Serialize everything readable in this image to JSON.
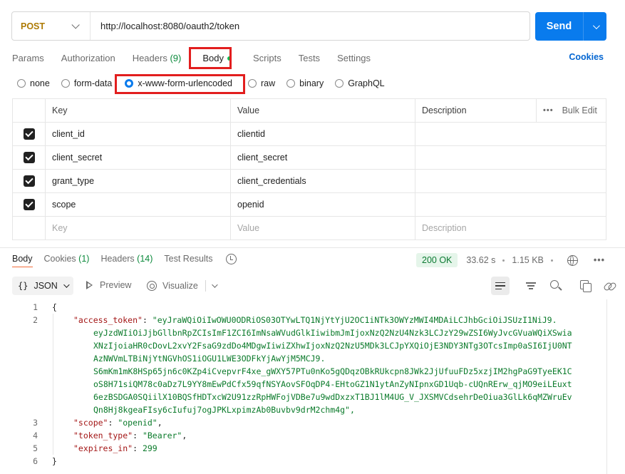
{
  "request": {
    "method": "POST",
    "url": "http://localhost:8080/oauth2/token",
    "send_label": "Send"
  },
  "request_tabs": {
    "params": "Params",
    "authorization": "Authorization",
    "headers": "Headers",
    "headers_count": "(9)",
    "body": "Body",
    "scripts": "Scripts",
    "tests": "Tests",
    "settings": "Settings",
    "cookies": "Cookies"
  },
  "body_types": {
    "none": "none",
    "form_data": "form-data",
    "urlencoded": "x-www-form-urlencoded",
    "raw": "raw",
    "binary": "binary",
    "graphql": "GraphQL",
    "selected": "x-www-form-urlencoded"
  },
  "params_table": {
    "headers": [
      "Key",
      "Value",
      "Description"
    ],
    "bulk_edit": "Bulk Edit",
    "rows": [
      {
        "key": "client_id",
        "value": "clientid",
        "checked": true
      },
      {
        "key": "client_secret",
        "value": "client_secret",
        "checked": true
      },
      {
        "key": "grant_type",
        "value": "client_credentials",
        "checked": true
      },
      {
        "key": "scope",
        "value": "openid",
        "checked": true
      }
    ],
    "placeholder": {
      "key": "Key",
      "value": "Value",
      "description": "Description"
    }
  },
  "response_tabs": {
    "body": "Body",
    "cookies": "Cookies",
    "cookies_count": "(1)",
    "headers": "Headers",
    "headers_count": "(14)",
    "test_results": "Test Results"
  },
  "response_status": {
    "code": "200 OK",
    "time": "33.62 s",
    "size": "1.15 KB"
  },
  "response_toolbar": {
    "format": "JSON",
    "preview": "Preview",
    "visualize": "Visualize"
  },
  "response_body": {
    "line_numbers": [
      "1",
      "2",
      "3",
      "4",
      "5",
      "6"
    ],
    "open_brace": "{",
    "close_brace": "}",
    "access_token_key": "\"access_token\"",
    "access_token_lines": [
      "\"eyJraWQiOiIwOWU0ODRiOS03OTYwLTQ1NjYtYjU2OC1iNTk3OWYzMWI4MDAiLCJhbGciOiJSUzI1NiJ9.",
      "eyJzdWIiOiJjbGllbnRpZCIsImF1ZCI6ImNsaWVudGlkIiwibmJmIjoxNzQ2NzU4Nzk3LCJzY29wZSI6WyJvcGVuaWQiXSwia",
      "XNzIjoiaHR0cDovL2xvY2FsaG9zdDo4MDgwIiwiZXhwIjoxNzQ2NzU5MDk3LCJpYXQiOjE3NDY3NTg3OTcsImp0aSI6IjU0NT",
      "AzNWVmLTBiNjYtNGVhOS1iOGU1LWE3ODFkYjAwYjM5MCJ9.",
      "S6mKm1mK8HSp65jn6c0KZp4iCvepvrF4xe_gWXY57PTu0nKo5gQDqzOBkRUkcpn8JWk2JjUfuuFDz5xzjIM2hgPaG9TyeEK1C",
      "oS8H71siQM78c0aDz7L9YY8mEwPdCfx59qfNSYAovSFOqDP4-EHtoGZ1N1ytAnZyNIpnxGD1Uqb-cUQnRErw_qjMO9eiLEuxt",
      "6ezBSDGA0SQiilX10BQSfHDTxcW2U91zzRpHWFojVDBe7u9wdDxzxT1BJ1lM4UG_V_JXSMVCdsehrDeOiua3GlLk6qMZWruEv",
      "Qn8Hj8kgeaFIsy6cIufuj7ogJPKLxpimzAb0Buvbv9drM2chm4g\","
    ],
    "scope_key": "\"scope\"",
    "scope_val": "\"openid\"",
    "token_type_key": "\"token_type\"",
    "token_type_val": "\"Bearer\"",
    "expires_in_key": "\"expires_in\"",
    "expires_in_val": "299"
  },
  "colors": {
    "send_button": "#097bed",
    "method": "#ad7a03",
    "highlight_box": "#e21e1e",
    "status_ok": "#0c7a32"
  }
}
